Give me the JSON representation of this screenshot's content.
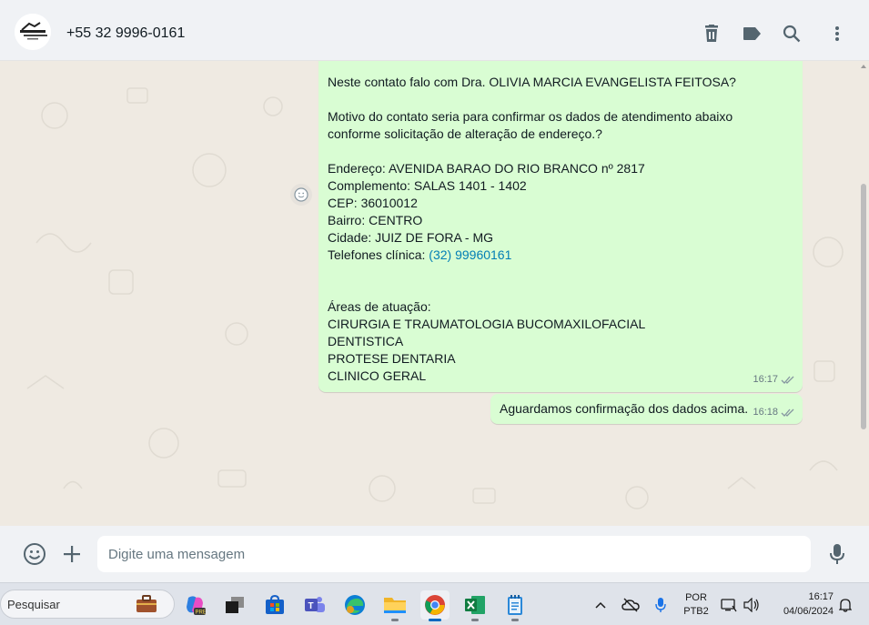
{
  "header": {
    "contact_name": "+55 32 9996-0161",
    "icons": [
      "trash-icon",
      "label-icon",
      "search-icon",
      "more-vertical-icon"
    ]
  },
  "messages": [
    {
      "lines": [
        "Neste contato falo com Dra. OLIVIA MARCIA EVANGELISTA FEITOSA?",
        "",
        "Motivo do contato seria para confirmar os dados de atendimento abaixo",
        "conforme solicitação de alteração de endereço.?",
        "",
        "Endereço: AVENIDA BARAO DO RIO BRANCO nº 2817",
        "Complemento: SALAS 1401 - 1402",
        "CEP: 36010012",
        "Bairro: CENTRO",
        "Cidade: JUIZ DE FORA - MG",
        "Telefones clínica: ",
        "",
        "",
        "Áreas de atuação:",
        "CIRURGIA E TRAUMATOLOGIA BUCOMAXILOFACIAL",
        "DENTISTICA",
        "PROTESE DENTARIA",
        "CLINICO GERAL"
      ],
      "phone_link": "(32) 99960161",
      "time": "16:17",
      "status": "read"
    },
    {
      "text": "Aguardamos confirmação dos dados acima.",
      "time": "16:18",
      "status": "read"
    }
  ],
  "composer": {
    "placeholder": "Digite uma mensagem"
  },
  "taskbar": {
    "search_label": "Pesquisar",
    "apps": [
      "briefcase-icon",
      "copilot-pre-icon",
      "task-view-icon",
      "store-icon",
      "teams-icon",
      "edge-icon",
      "file-explorer-icon",
      "chrome-icon",
      "excel-icon",
      "notepad-icon"
    ],
    "lang_top": "POR",
    "lang_bottom": "PTB2",
    "time": "16:17",
    "date": "04/06/2024"
  },
  "colors": {
    "bubble_outgoing": "#d9fdd3",
    "chat_background": "#efeae2",
    "link": "#027eb5"
  }
}
